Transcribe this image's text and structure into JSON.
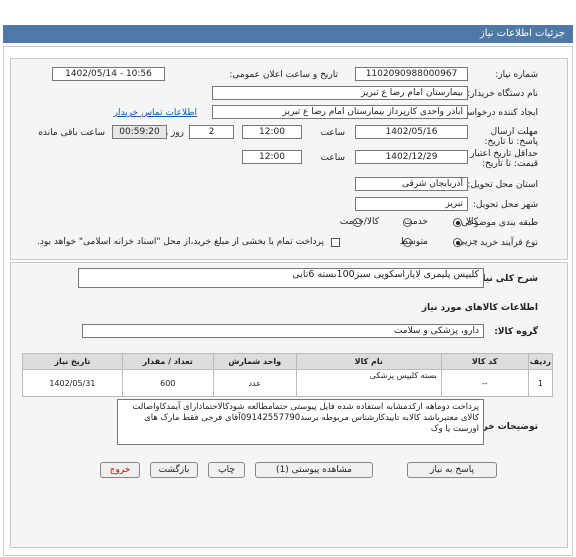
{
  "header": {
    "title": "جزئیات اطلاعات نیاز"
  },
  "form": {
    "need_number_label": "شماره نیاز:",
    "need_number": "1102090988000967",
    "announce_label": "تاریخ و ساعت اعلان عمومی:",
    "announce_value": "1402/05/14 - 10:56",
    "buyer_org_label": "نام دستگاه خریدار:",
    "buyer_org": "بیمارستان امام رضا  ع  تبریز",
    "creator_label": "ایجاد کننده درخواست:",
    "creator": "اباذر واحدی کارپرداز بیمارستان امام رضا  ع  تبریز",
    "contact_link": "اطلاعات تماس خریدار",
    "deadline_label": "مهلت ارسال پاسخ: تا تاریخ:",
    "deadline_date": "1402/05/16",
    "time_label": "ساعت",
    "deadline_time": "12:00",
    "days_value": "2",
    "days_label": "روز و",
    "remaining_time": "00:59:20",
    "remaining_label": "ساعت باقی مانده",
    "min_validity_label": "حداقل تاریخ اعتبار قیمت: تا تاریخ:",
    "validity_date": "1402/12/29",
    "validity_time_label": "ساعت",
    "validity_time": "12:00",
    "province_label": "استان محل تحویل:",
    "province": "آذربایجان شرقی",
    "city_label": "شهر محل تحویل:",
    "city": "تبریز",
    "category_label": "طبقه بندی موضوعی:",
    "category_options": [
      "کالا",
      "خدمت",
      "کالا/خدمت"
    ],
    "category_selected": "کالا",
    "process_label": "نوع فرآیند خرید :",
    "process_options": [
      "جزیی",
      "متوسط"
    ],
    "process_selected": "جزیی",
    "payment_note": "پرداخت تمام یا بخشی از مبلغ خرید،از محل \"اسناد خزانه اسلامی\" خواهد بود."
  },
  "details": {
    "summary_label": "شرح کلی نیاز:",
    "summary": "کلیپس پلیمری لاپاراسکوپی سبز100بسته 6تایی",
    "goods_info_title": "اطلاعات کالاهای مورد نیاز",
    "goods_group_label": "گروه کالا:",
    "goods_group": "دارو، پزشکی و سلامت",
    "table_headers": [
      "ردیف",
      "کد کالا",
      "نام کالا",
      "واحد شمارش",
      "تعداد / مقدار",
      "تاریخ نیاز"
    ],
    "table_rows": [
      [
        "1",
        "--",
        "بسته کلیپس پزشکی",
        "عدد",
        "600",
        "1402/05/31"
      ]
    ],
    "buyer_notes_label": "توضیحات خریدار:",
    "buyer_notes": "پرداخت دوماهه ازکدمشابه استفاده شده فایل پیوستی حتمامطالعه شودکالاحتمادارای آیمدکاواصالت کالای معتبرباشد کالابه تاییدکارشناس مربوطه برسد09142557790آقای فرجی فقط مارک های اورست یا وک"
  },
  "buttons": {
    "reply": "پاسخ به نیاز",
    "attachments": "مشاهده پیوستی (1)",
    "print": "چاپ",
    "back": "بازگشت",
    "exit": "خروج"
  }
}
